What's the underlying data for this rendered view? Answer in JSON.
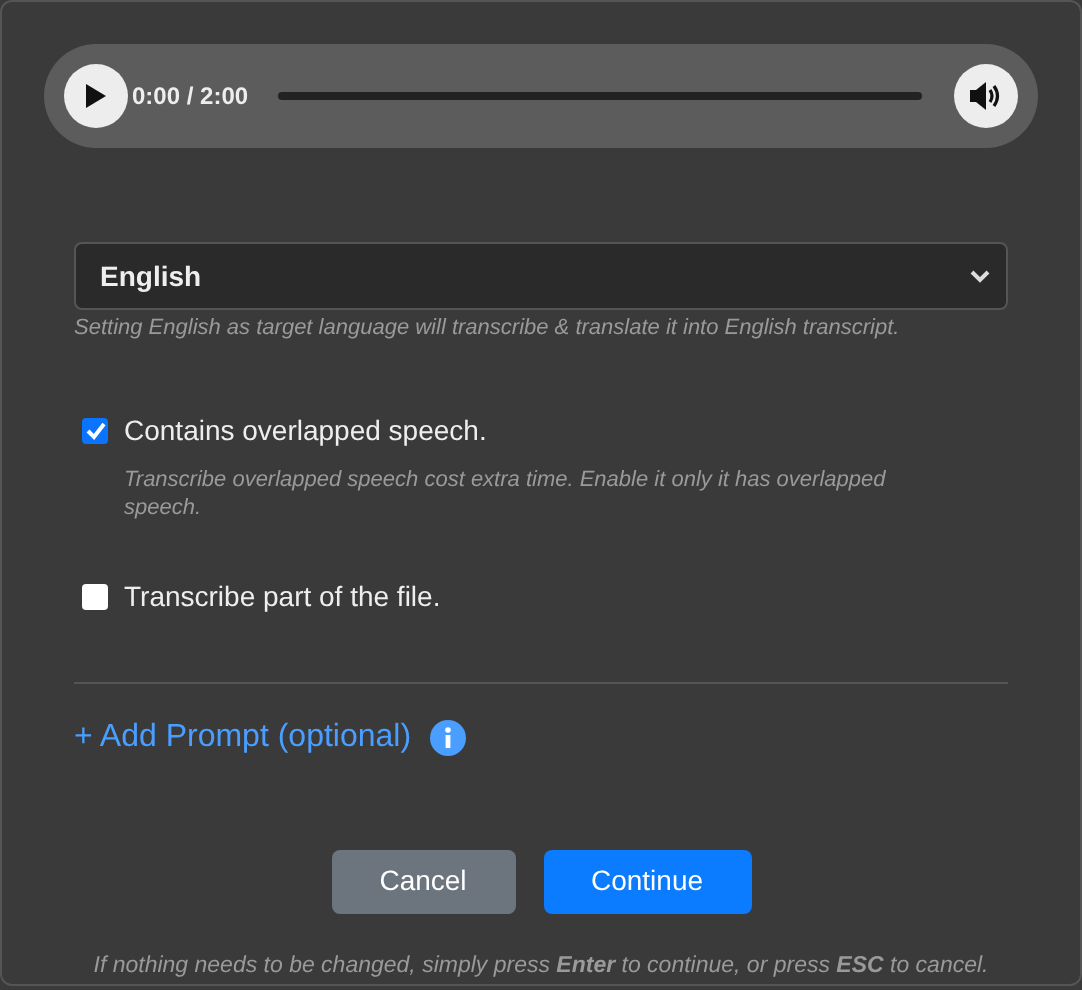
{
  "audio_player": {
    "time": "0:00 / 2:00"
  },
  "language_select": {
    "value": "English",
    "hint": "Setting English as target language will transcribe & translate it into English transcript."
  },
  "options": [
    {
      "label": "Contains overlapped speech.",
      "checked": true,
      "hint": "Transcribe overlapped speech cost extra time. Enable it only it has overlapped speech."
    },
    {
      "label": "Transcribe part of the file.",
      "checked": false
    }
  ],
  "add_prompt_link": "+ Add Prompt (optional)",
  "buttons": [
    {
      "label": "Cancel",
      "kind": "secondary"
    },
    {
      "label": "Continue",
      "kind": "primary"
    }
  ],
  "footer_note": "If nothing needs to be changed, simply press **Enter** to continue, or press **ESC** to cancel."
}
